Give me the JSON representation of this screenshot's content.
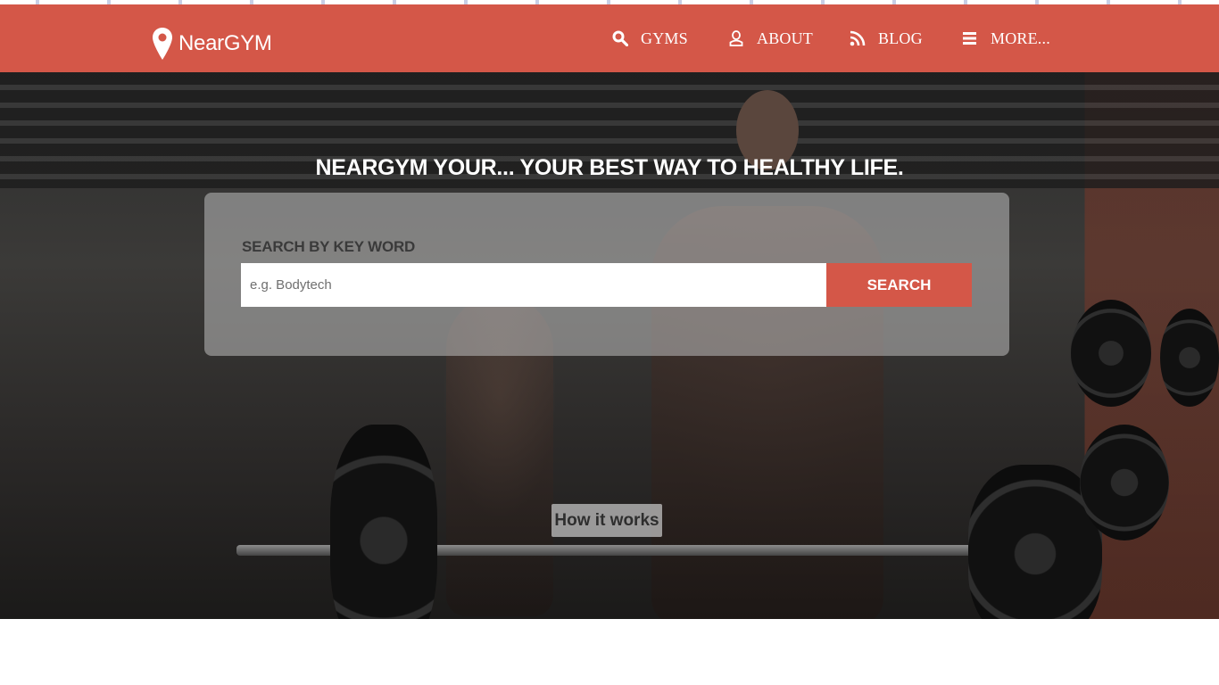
{
  "brand": {
    "name": "NearGYM",
    "icon": "map-pin-icon"
  },
  "nav": {
    "items": [
      {
        "label": "GYMS",
        "icon": "search-icon"
      },
      {
        "label": "ABOUT",
        "icon": "user-icon"
      },
      {
        "label": "BLOG",
        "icon": "rss-icon"
      },
      {
        "label": "MORE...",
        "icon": "menu-icon"
      }
    ]
  },
  "hero": {
    "title": "NEARGYM YOUR... YOUR BEST WAY TO HEALTHY LIFE.",
    "search": {
      "label": "SEARCH BY KEY WORD",
      "placeholder": "e.g. Bodytech",
      "value": "",
      "button_label": "SEARCH"
    },
    "how_it_works_label": "How it works"
  },
  "colors": {
    "brand": "#d45748",
    "nav_text": "#ffffff",
    "panel": "rgba(190,190,190,0.55)"
  }
}
